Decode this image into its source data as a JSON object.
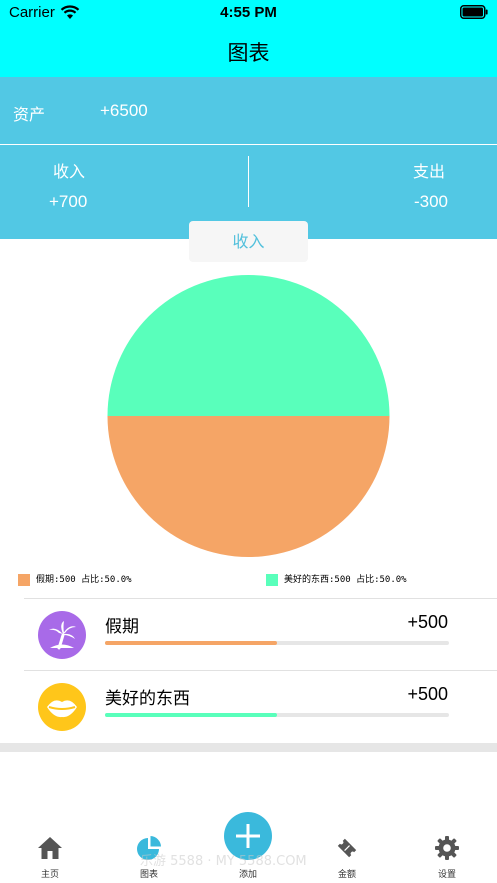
{
  "status_bar": {
    "carrier": "Carrier",
    "time": "4:55 PM"
  },
  "nav": {
    "title": "图表"
  },
  "summary": {
    "asset_label": "资产",
    "asset_value": "+6500",
    "income_label": "收入",
    "income_value": "+700",
    "expense_label": "支出",
    "expense_value": "-300"
  },
  "segment": {
    "selected": "收入"
  },
  "chart_data": {
    "type": "pie",
    "categories": [
      "假期",
      "美好的东西"
    ],
    "values": [
      500,
      500
    ],
    "colors": [
      "#f5a566",
      "#59ffbb"
    ]
  },
  "legend": [
    {
      "text": "假期:500  占比:50.0%",
      "color": "#f5a566"
    },
    {
      "text": "美好的东西:500  占比:50.0%",
      "color": "#59ffbb"
    }
  ],
  "items": [
    {
      "name": "假期",
      "amount": "+500",
      "share": 0.5,
      "color": "#f5a566",
      "icon": "palm-tree-icon",
      "icon_color": "#a86ae8"
    },
    {
      "name": "美好的东西",
      "amount": "+500",
      "share": 0.5,
      "color": "#59ffbb",
      "icon": "lips-icon",
      "icon_color": "#ffc61a"
    }
  ],
  "tabs": [
    {
      "label": "主页",
      "icon": "home-icon"
    },
    {
      "label": "图表",
      "icon": "pie-chart-icon"
    },
    {
      "label": "添加",
      "icon": "plus-icon"
    },
    {
      "label": "金额",
      "icon": "ticket-icon"
    },
    {
      "label": "设置",
      "icon": "gear-icon"
    }
  ],
  "watermark": "乐游 5588 · MY 5588.COM",
  "colors": {
    "bar": "#00ffff",
    "header": "#52c8e4",
    "accent": "#3ab9dc"
  }
}
